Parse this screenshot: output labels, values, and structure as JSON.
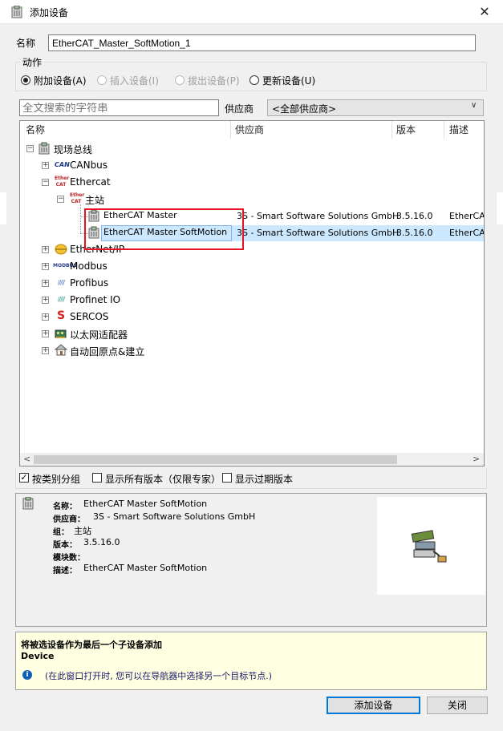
{
  "window": {
    "title": "添加设备",
    "close_glyph": "✕"
  },
  "name_field": {
    "label": "名称",
    "value": "EtherCAT_Master_SoftMotion_1"
  },
  "action": {
    "legend": "动作",
    "options": [
      {
        "label": "附加设备(A)",
        "selected": true,
        "enabled": true
      },
      {
        "label": "插入设备(I)",
        "selected": false,
        "enabled": false
      },
      {
        "label": "拔出设备(P)",
        "selected": false,
        "enabled": false
      },
      {
        "label": "更新设备(U)",
        "selected": false,
        "enabled": true
      }
    ]
  },
  "search": {
    "placeholder": "全文搜索的字符串",
    "vendor_label": "供应商",
    "vendor_value": "<全部供应商>"
  },
  "tree": {
    "columns": [
      "名称",
      "供应商",
      "版本",
      "描述"
    ],
    "root": "现场总线",
    "nodes": [
      {
        "label": "CANbus",
        "icon": "CAN"
      },
      {
        "label": "Ethercat",
        "icon": "EtherCAT"
      },
      {
        "label": "主站",
        "icon": "EtherCAT"
      },
      {
        "label": "EtherCAT Master",
        "vendor": "3S - Smart Software Solutions GmbH",
        "version": "3.5.16.0",
        "desc": "EtherCAT"
      },
      {
        "label": "EtherCAT Master SoftMotion",
        "vendor": "3S - Smart Software Solutions GmbH",
        "version": "3.5.16.0",
        "desc": "EtherCAT"
      },
      {
        "label": "EtherNet/IP"
      },
      {
        "label": "Modbus"
      },
      {
        "label": "Profibus"
      },
      {
        "label": "Profinet IO"
      },
      {
        "label": "SERCOS"
      },
      {
        "label": "以太网适配器"
      },
      {
        "label": "自动回原点&建立"
      }
    ]
  },
  "options": [
    {
      "label": "按类别分组",
      "checked": true
    },
    {
      "label": "显示所有版本（仅限专家）",
      "checked": false
    },
    {
      "label": "显示过期版本",
      "checked": false
    }
  ],
  "info": {
    "rows": [
      {
        "key": "名称：",
        "value": "EtherCAT Master SoftMotion"
      },
      {
        "key": "供应商：",
        "value": "3S - Smart Software Solutions GmbH"
      },
      {
        "key": "组：",
        "value": "主站"
      },
      {
        "key": "版本：",
        "value": "3.5.16.0"
      },
      {
        "key": "模块数：",
        "value": ""
      },
      {
        "key": "描述：",
        "value": "EtherCAT Master SoftMotion"
      }
    ]
  },
  "hint": {
    "title": "将被选设备作为最后一个子设备添加",
    "subtitle": "Device",
    "note": "(在此窗口打开时, 您可以在导航器中选择另一个目标节点.)"
  },
  "buttons": {
    "add": "添加设备",
    "close": "关闭"
  },
  "colors": {
    "selection": "#cce8ff",
    "highlight": "#e81123",
    "hint_bg": "#ffffe1",
    "info_icon": "#0b5fb8"
  }
}
